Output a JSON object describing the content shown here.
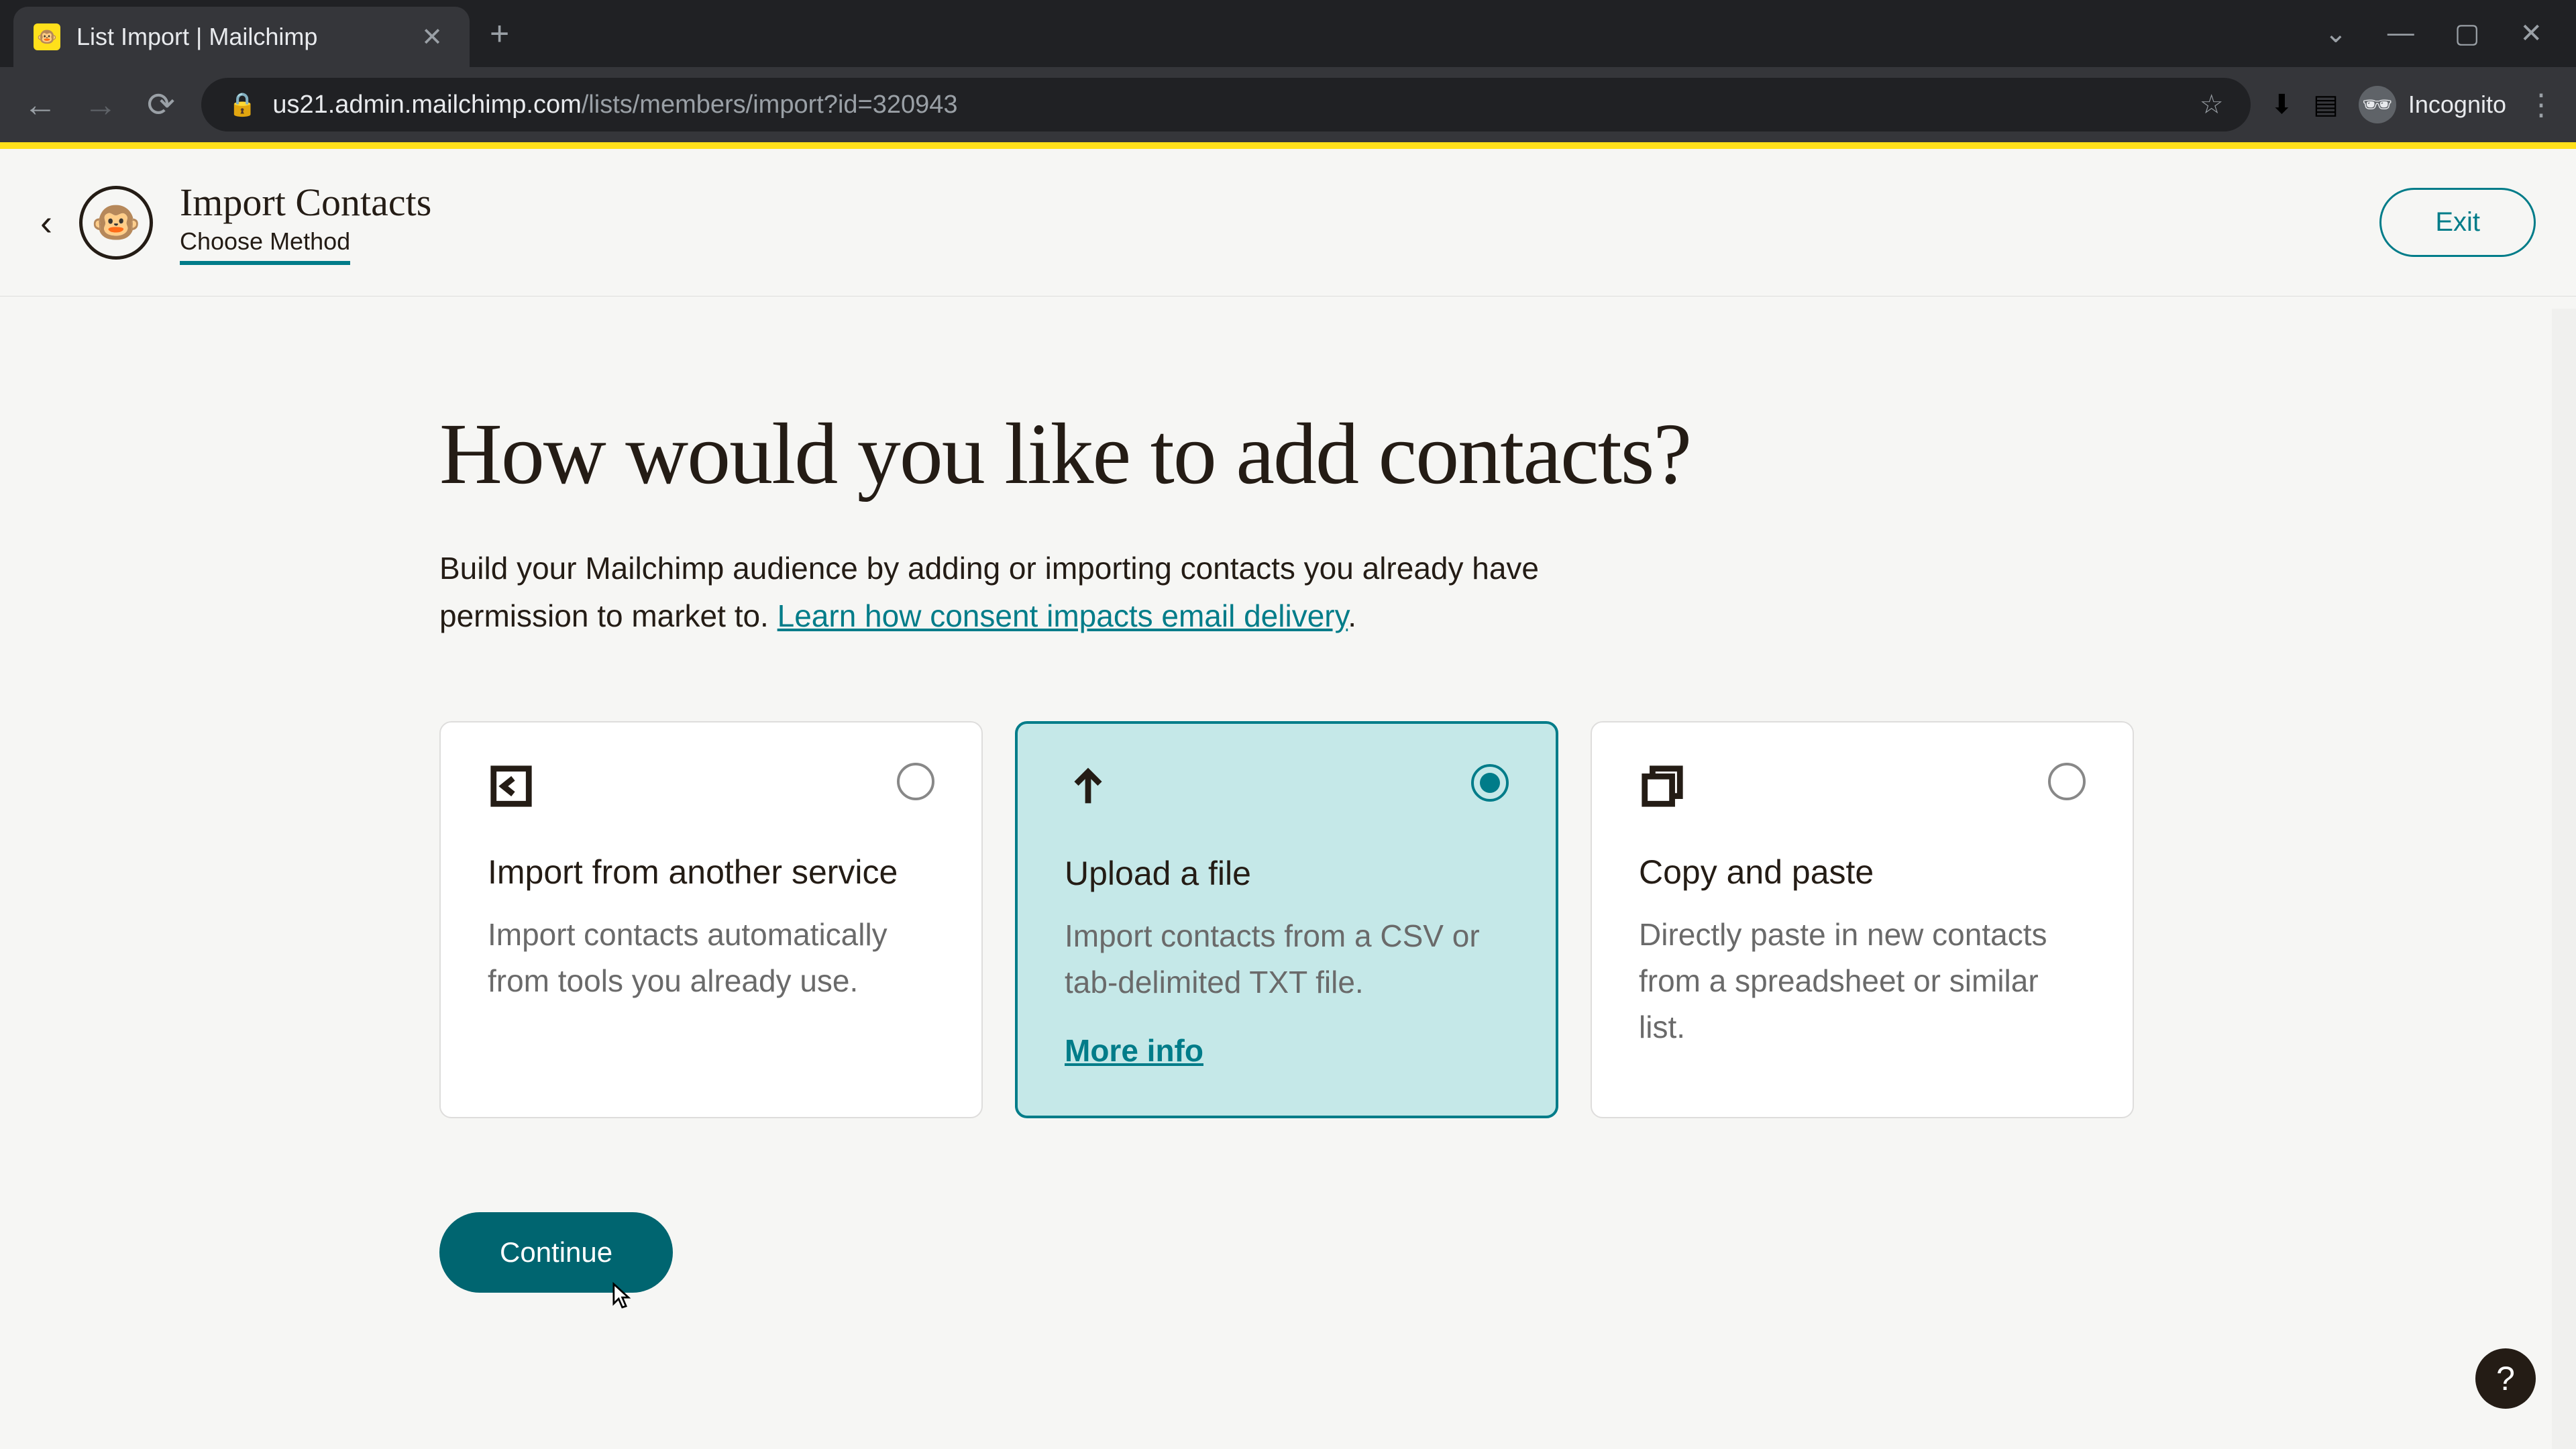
{
  "browser": {
    "tab_title": "List Import | Mailchimp",
    "url_domain": "us21.admin.mailchimp.com",
    "url_path": "/lists/members/import?id=320943",
    "incognito_label": "Incognito"
  },
  "header": {
    "title": "Import Contacts",
    "subtitle": "Choose Method",
    "exit_label": "Exit"
  },
  "main": {
    "heading": "How would you like to add contacts?",
    "desc_prefix": "Build your Mailchimp audience by adding or importing contacts you already have permission to market to. ",
    "desc_link": "Learn how consent impacts email delivery",
    "desc_suffix": "."
  },
  "cards": [
    {
      "title": "Import from another service",
      "desc": "Import contacts automatically from tools you already use.",
      "selected": false
    },
    {
      "title": "Upload a file",
      "desc": "Import contacts from a CSV or tab-delimited TXT file.",
      "more_info": "More info",
      "selected": true
    },
    {
      "title": "Copy and paste",
      "desc": "Directly paste in new contacts from a spreadsheet or similar list.",
      "selected": false
    }
  ],
  "continue_label": "Continue",
  "help_label": "?"
}
